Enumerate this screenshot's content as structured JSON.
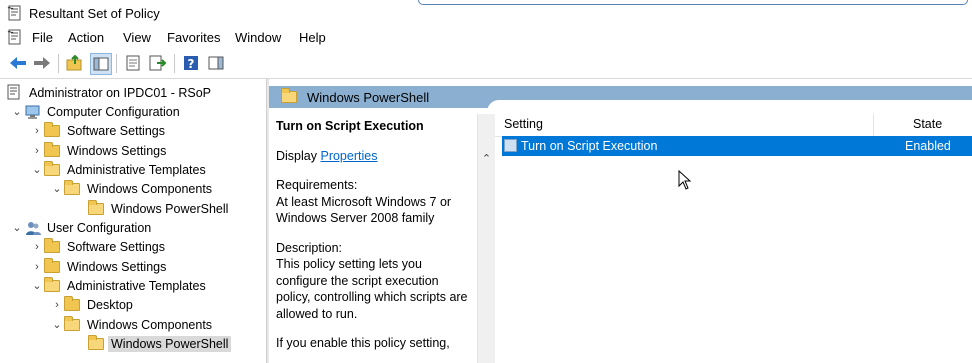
{
  "window": {
    "title": "Resultant Set of Policy"
  },
  "menu": [
    "File",
    "Action",
    "View",
    "Favorites",
    "Window",
    "Help"
  ],
  "toolbar": [
    "back-icon",
    "forward-icon",
    "up-folder-icon",
    "show-hide-tree-icon",
    "properties-icon",
    "export-list-icon",
    "help-icon",
    "show-action-pane-icon"
  ],
  "tree": {
    "root": "Administrator on IPDC01 - RSoP",
    "computer": {
      "label": "Computer Configuration",
      "software": "Software Settings",
      "windows": "Windows Settings",
      "admin": "Administrative Templates",
      "components": "Windows Components",
      "powershell": "Windows PowerShell"
    },
    "user": {
      "label": "User Configuration",
      "software": "Software Settings",
      "windows": "Windows Settings",
      "admin": "Administrative Templates",
      "desktop": "Desktop",
      "components": "Windows Components",
      "powershell": "Windows PowerShell"
    }
  },
  "panel": {
    "header": "Windows PowerShell",
    "desc_title": "Turn on Script Execution",
    "display_label": "Display",
    "display_link": "Properties",
    "requirements_label": "Requirements:",
    "requirements_text": "At least Microsoft Windows 7 or Windows Server 2008 family",
    "description_label": "Description:",
    "description_text": "This policy setting lets you configure the script execution policy, controlling which scripts are allowed to run.",
    "more_text": "If you enable this policy setting,"
  },
  "list": {
    "col_setting": "Setting",
    "col_state": "State",
    "rows": [
      {
        "setting": "Turn on Script Execution",
        "state": "Enabled"
      }
    ]
  },
  "colors": {
    "selection": "#0078d7",
    "header_band": "#8aafd0",
    "link": "#0066cc"
  }
}
